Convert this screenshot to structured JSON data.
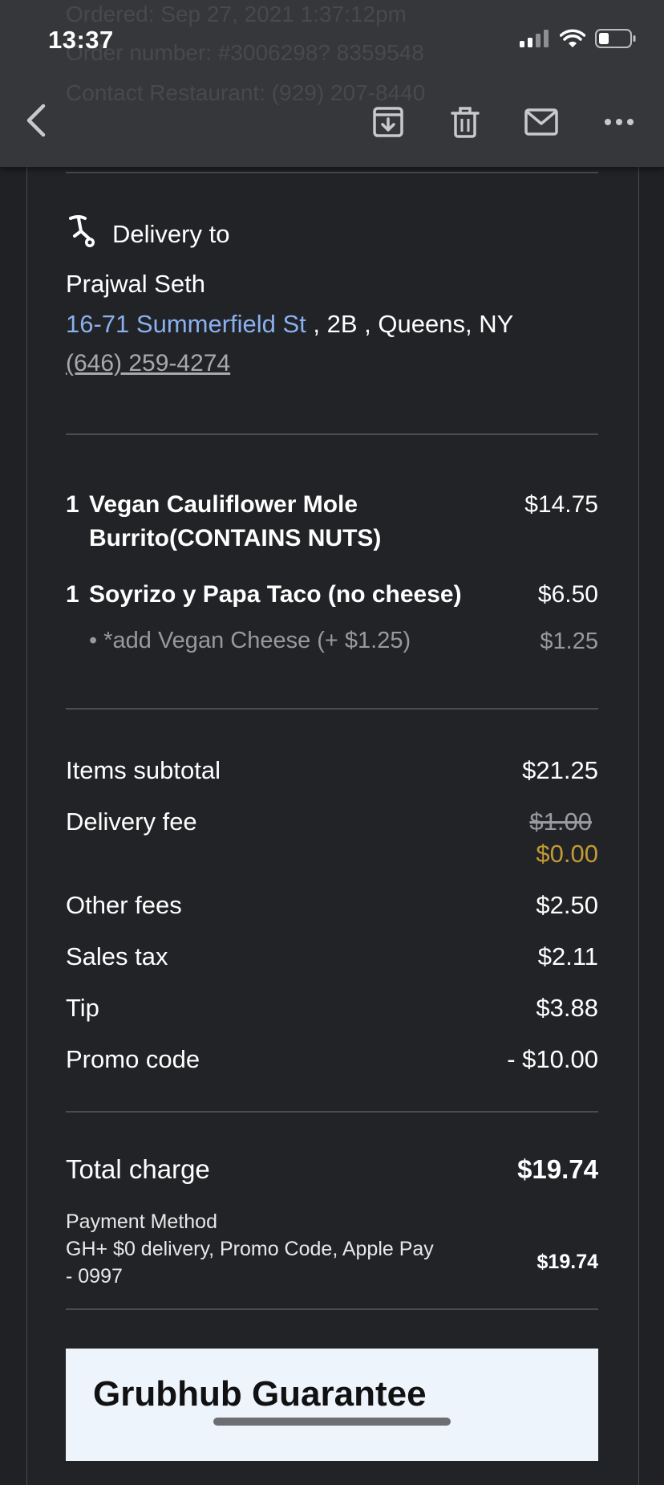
{
  "status_bar": {
    "time": "13:37"
  },
  "header_ghost": {
    "line1": "Ordered: Sep 27, 2021 1:37:12pm",
    "line2": "Order number: #3006298? 8359548",
    "line3": "Contact Restaurant: (929) 207-8440"
  },
  "icons": {
    "back": "chevron-left-icon",
    "archive": "archive-icon",
    "trash": "trash-icon",
    "mail": "mail-icon",
    "more": "more-horizontal-icon",
    "delivery": "scooter-icon"
  },
  "delivery": {
    "label": "Delivery to",
    "name": "Prajwal Seth",
    "street": "16-71 Summerfield St",
    "address_rest": " , 2B , Queens, NY",
    "phone": "(646) 259-4274"
  },
  "items": [
    {
      "qty": "1",
      "name_line1": "Vegan Cauliflower Mole",
      "name_line2": "Burrito(CONTAINS NUTS)",
      "price": "$14.75"
    },
    {
      "qty": "1",
      "name_line1": "Soyrizo y Papa Taco (no cheese)",
      "price": "$6.50",
      "addon": "• *add Vegan Cheese (+ $1.25)",
      "addon_price": "$1.25"
    }
  ],
  "summary": {
    "subtotal_label": "Items subtotal",
    "subtotal": "$21.25",
    "delivery_label": "Delivery fee",
    "delivery_original": "$1.00",
    "delivery_final": "$0.00",
    "other_label": "Other fees",
    "other": "$2.50",
    "tax_label": "Sales tax",
    "tax": "$2.11",
    "tip_label": "Tip",
    "tip": "$3.88",
    "promo_label": "Promo code",
    "promo": "- $10.00"
  },
  "total": {
    "label": "Total charge",
    "value": "$19.74"
  },
  "payment": {
    "title": "Payment Method",
    "line1": "GH+ $0 delivery, Promo Code, Apple Pay",
    "line2": "- 0997",
    "amount": "$19.74"
  },
  "guarantee": {
    "title": "Grubhub Guarantee"
  },
  "colors": {
    "background": "#202124",
    "toolbar": "#36373a",
    "link": "#8ab0f0",
    "discount": "#c39a36"
  }
}
